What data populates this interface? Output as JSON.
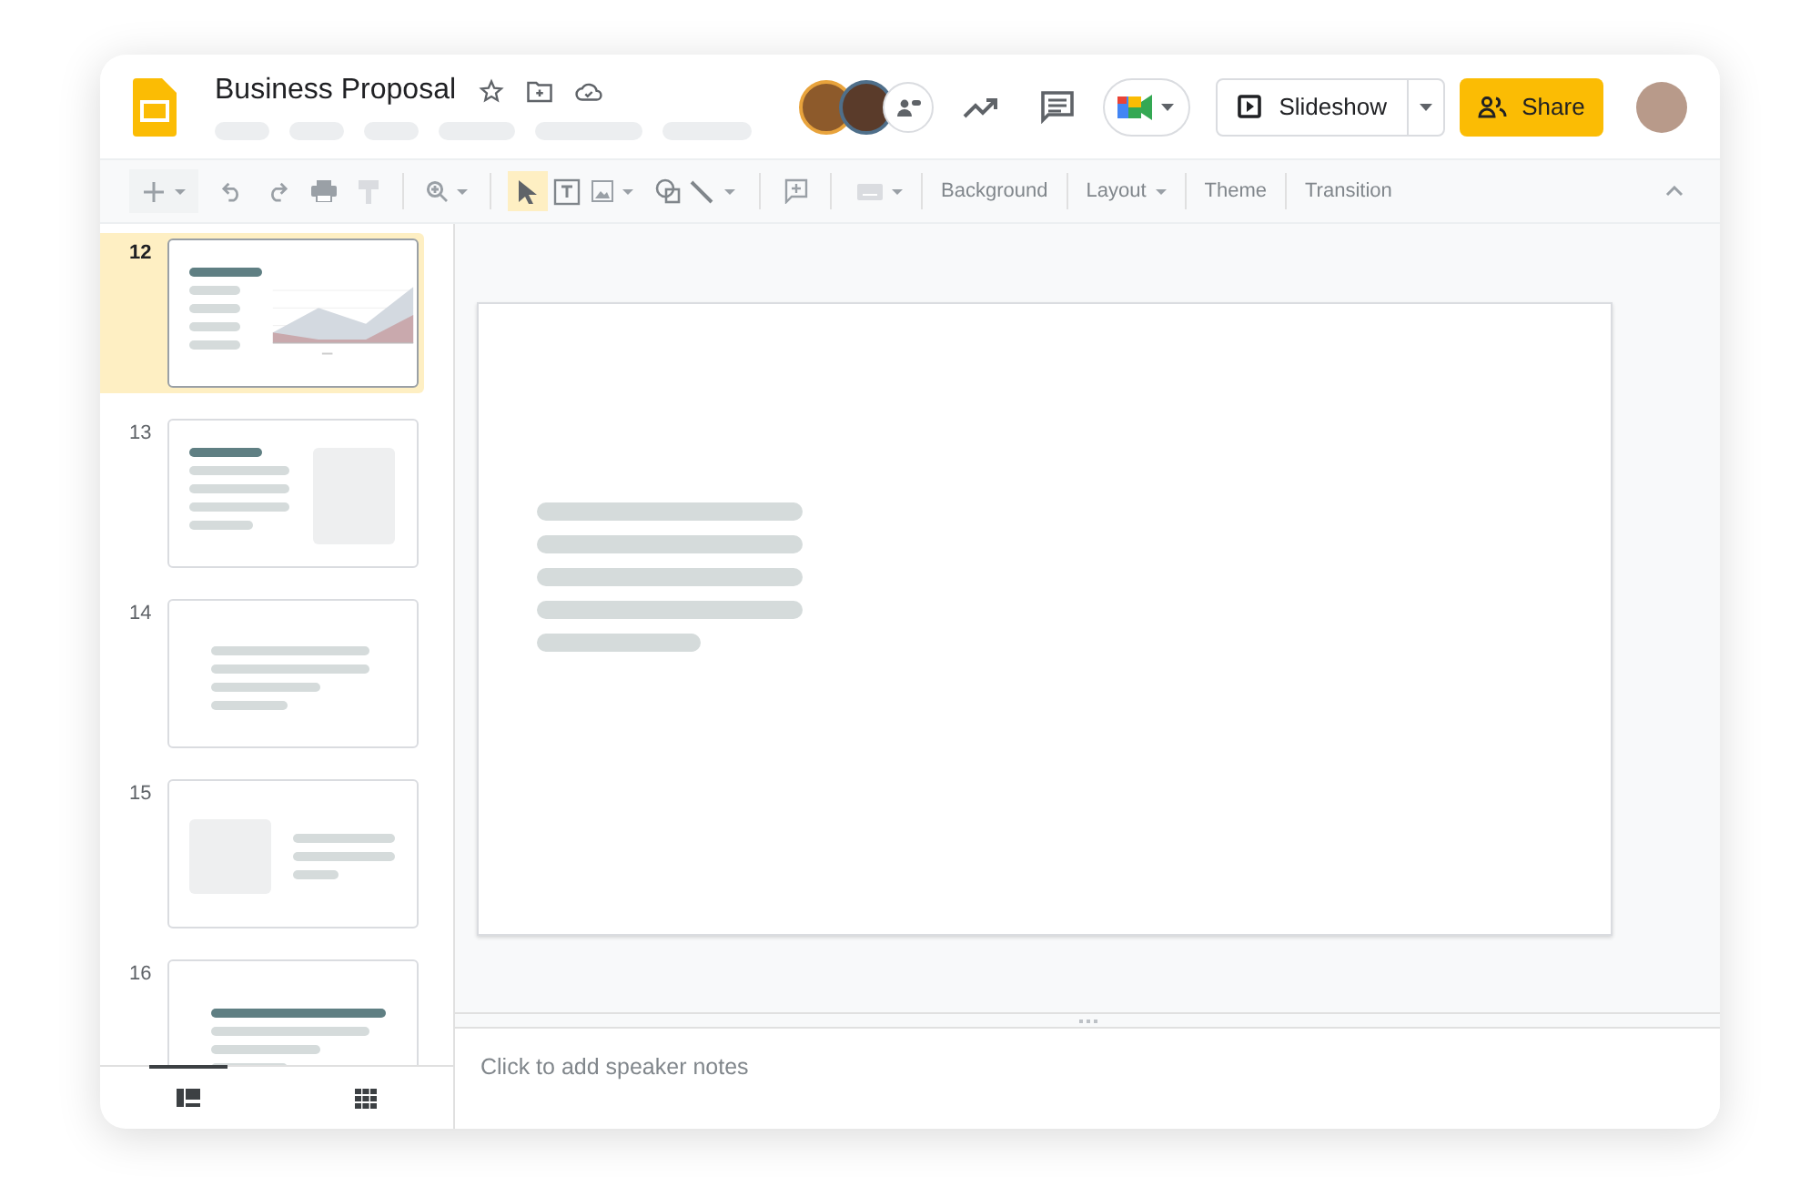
{
  "document": {
    "title": "Business Proposal"
  },
  "header": {
    "slideshow_label": "Slideshow",
    "share_label": "Share"
  },
  "toolbar": {
    "select_tool": {
      "selected": true
    },
    "labels": [
      "Background",
      "Layout",
      "Theme",
      "Transition"
    ]
  },
  "slides": [
    {
      "number": "12",
      "kind": "chart",
      "selected": true
    },
    {
      "number": "13",
      "kind": "image-right",
      "selected": false
    },
    {
      "number": "14",
      "kind": "text",
      "selected": false
    },
    {
      "number": "15",
      "kind": "image-left",
      "selected": false
    },
    {
      "number": "16",
      "kind": "title",
      "selected": false
    }
  ],
  "view_toggle": [
    {
      "selected": true
    },
    {
      "selected": false
    }
  ],
  "notes": {
    "placeholder": "Click to add speaker notes"
  }
}
